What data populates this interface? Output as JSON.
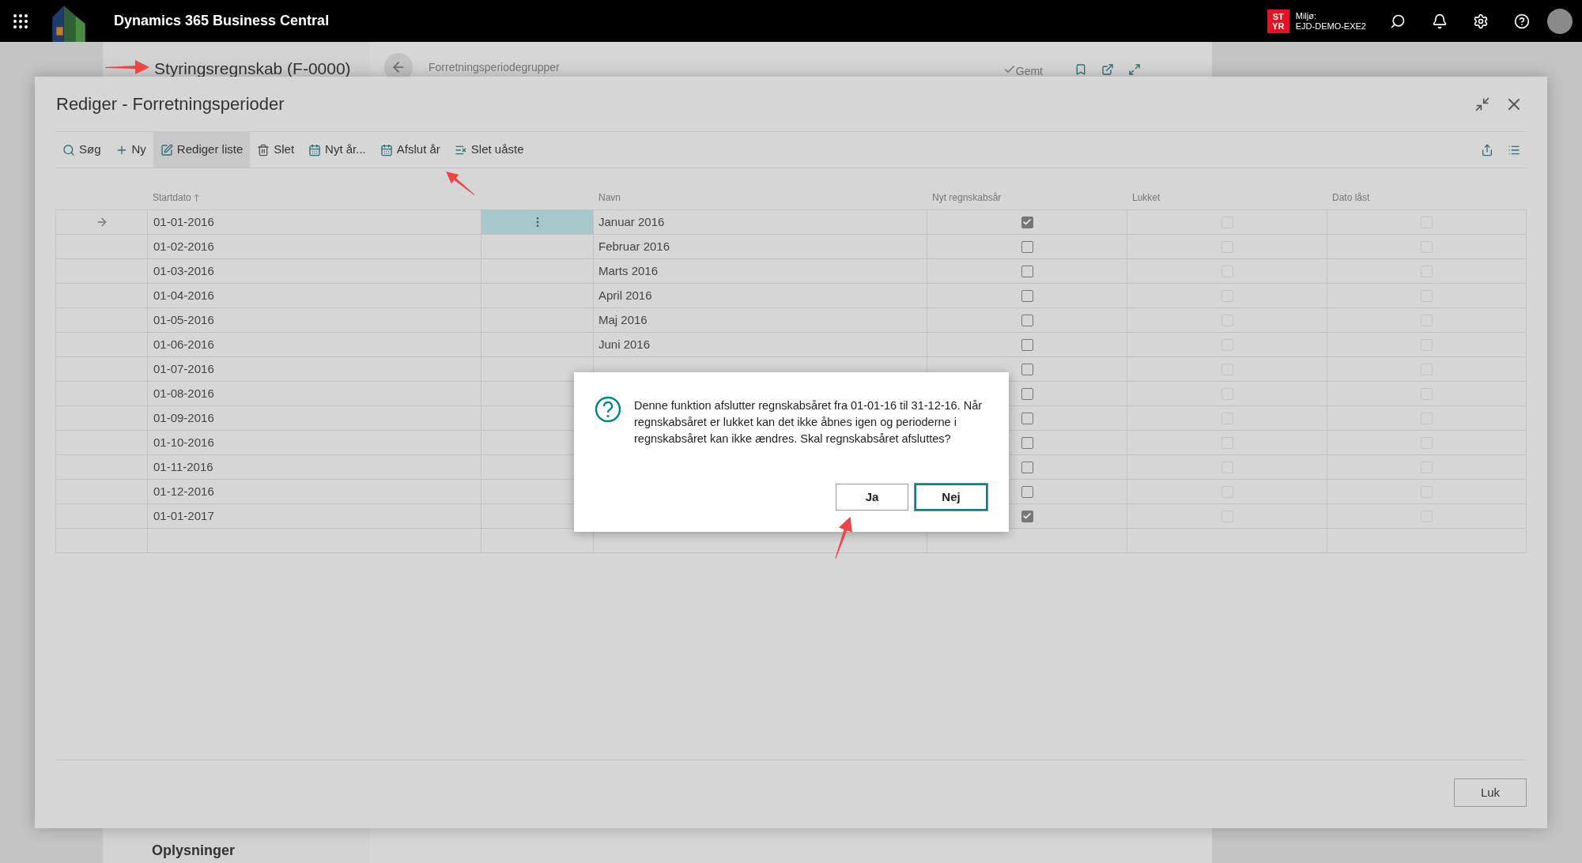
{
  "topbar": {
    "app_title": "Dynamics 365 Business Central",
    "environment": {
      "badge_lines": [
        "ST",
        "YR"
      ],
      "label": "Miljø:",
      "name": "EJD-DEMO-EXE2"
    }
  },
  "background_page": {
    "title": "Styringsregnskab (F-0000)",
    "subpage": "Forretningsperiodegrupper",
    "status": "Gemt",
    "section": "Oplysninger"
  },
  "modal": {
    "title": "Rediger - Forretningsperioder",
    "actions": [
      {
        "label": "Søg",
        "kind": "search",
        "selected": false
      },
      {
        "label": "Ny",
        "kind": "new",
        "selected": false
      },
      {
        "label": "Rediger liste",
        "kind": "edit",
        "selected": true
      },
      {
        "label": "Slet",
        "kind": "delete",
        "selected": false
      },
      {
        "label": "Nyt år...",
        "kind": "calendar",
        "selected": false
      },
      {
        "label": "Afslut år",
        "kind": "calendar",
        "selected": false
      },
      {
        "label": "Slet uåste",
        "kind": "remove",
        "selected": false
      }
    ],
    "columns": [
      {
        "label": "Startdato",
        "sorted": true
      },
      {
        "label": "Navn"
      },
      {
        "label": "Nyt regnskabsår"
      },
      {
        "label": "Lukket"
      },
      {
        "label": "Dato låst"
      }
    ],
    "locked_columns_disabled": true,
    "rows": [
      {
        "start": "01-01-2016",
        "name": "Januar 2016",
        "new_fiscal_year": true,
        "closed": false,
        "date_locked": false,
        "current": true
      },
      {
        "start": "01-02-2016",
        "name": "Februar 2016",
        "new_fiscal_year": false,
        "closed": false,
        "date_locked": false,
        "current": false
      },
      {
        "start": "01-03-2016",
        "name": "Marts 2016",
        "new_fiscal_year": false,
        "closed": false,
        "date_locked": false,
        "current": false
      },
      {
        "start": "01-04-2016",
        "name": "April 2016",
        "new_fiscal_year": false,
        "closed": false,
        "date_locked": false,
        "current": false
      },
      {
        "start": "01-05-2016",
        "name": "Maj 2016",
        "new_fiscal_year": false,
        "closed": false,
        "date_locked": false,
        "current": false
      },
      {
        "start": "01-06-2016",
        "name": "Juni 2016",
        "new_fiscal_year": false,
        "closed": false,
        "date_locked": false,
        "current": false
      },
      {
        "start": "01-07-2016",
        "new_fiscal_year": false,
        "closed": false,
        "date_locked": false,
        "current": false
      },
      {
        "start": "01-08-2016",
        "new_fiscal_year": false,
        "closed": false,
        "date_locked": false,
        "current": false
      },
      {
        "start": "01-09-2016",
        "new_fiscal_year": false,
        "closed": false,
        "date_locked": false,
        "current": false
      },
      {
        "start": "01-10-2016",
        "new_fiscal_year": false,
        "closed": false,
        "date_locked": false,
        "current": false
      },
      {
        "start": "01-11-2016",
        "new_fiscal_year": false,
        "closed": false,
        "date_locked": false,
        "current": false
      },
      {
        "start": "01-12-2016",
        "new_fiscal_year": false,
        "closed": false,
        "date_locked": false,
        "current": false
      },
      {
        "start": "01-01-2017",
        "new_fiscal_year": true,
        "closed": false,
        "date_locked": false,
        "current": false
      }
    ],
    "close_button": "Luk"
  },
  "confirm_dialog": {
    "message": "Denne funktion afslutter regnskabsåret fra 01-01-16 til 31-12-16. Når regnskabsåret er lukket kan det ikke åbnes igen og perioderne i regnskabsåret kan ikke ændres. Skal regnskabsåret afsluttes?",
    "buttons": [
      {
        "label": "Ja",
        "focused": false
      },
      {
        "label": "Nej",
        "focused": true
      }
    ]
  }
}
